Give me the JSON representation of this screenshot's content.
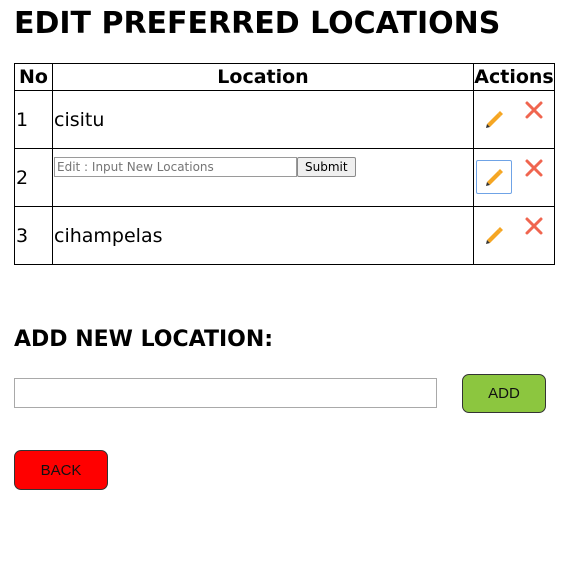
{
  "page": {
    "title": "EDIT PREFERRED LOCATIONS"
  },
  "table": {
    "headers": [
      "No",
      "Location",
      "Actions"
    ],
    "rows": [
      {
        "no": "1",
        "location": "cisitu",
        "editing": false
      },
      {
        "no": "2",
        "location": "",
        "editing": true
      },
      {
        "no": "3",
        "location": "cihampelas",
        "editing": false
      }
    ],
    "edit_form": {
      "placeholder": "Edit : Input New Locations",
      "value": "",
      "submit_label": "Submit"
    }
  },
  "icons": {
    "edit": "pencil-icon",
    "delete": "close-icon",
    "pencil_color": "#f5a623",
    "delete_color": "#f0654f"
  },
  "add_section": {
    "title": "ADD NEW LOCATION:",
    "input_value": "",
    "add_label": "ADD",
    "add_color": "#8cc63f"
  },
  "back": {
    "label": "BACK",
    "color": "#ff0000"
  }
}
